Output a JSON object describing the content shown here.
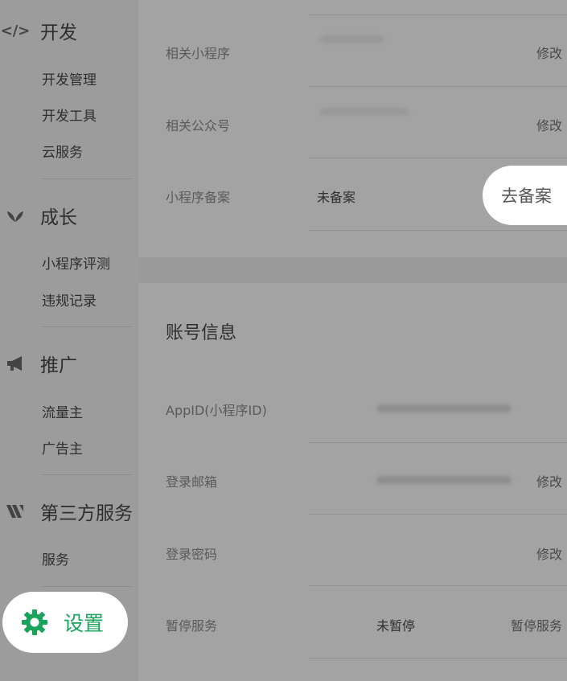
{
  "sidebar": {
    "sections": [
      {
        "icon": "code-icon",
        "title": "开发",
        "items": [
          "开发管理",
          "开发工具",
          "云服务"
        ]
      },
      {
        "icon": "sprout-icon",
        "title": "成长",
        "items": [
          "小程序评测",
          "违规记录"
        ]
      },
      {
        "icon": "megaphone-icon",
        "title": "推广",
        "items": [
          "流量主",
          "广告主"
        ]
      },
      {
        "icon": "third-party-icon",
        "title": "第三方服务",
        "items": [
          "服务"
        ]
      }
    ],
    "settings": {
      "label": "设置",
      "icon": "gear-icon"
    }
  },
  "main": {
    "related": {
      "rows": [
        {
          "label": "相关小程序",
          "value": "",
          "action": "修改"
        },
        {
          "label": "相关公众号",
          "value": "",
          "action": "修改"
        },
        {
          "label": "小程序备案",
          "value": "未备案",
          "action": "去备案"
        }
      ]
    },
    "account": {
      "title": "账号信息",
      "rows": [
        {
          "label": "AppID(小程序ID)",
          "value": "",
          "action": ""
        },
        {
          "label": "登录邮箱",
          "value": "",
          "action": "修改"
        },
        {
          "label": "登录密码",
          "value": "",
          "action": "修改"
        },
        {
          "label": "暂停服务",
          "value": "未暂停",
          "action": "暂停服务"
        }
      ]
    }
  },
  "colors": {
    "accent": "#1aa35a",
    "overlay": "#9c9c9c",
    "highlight": "#ffffff"
  }
}
